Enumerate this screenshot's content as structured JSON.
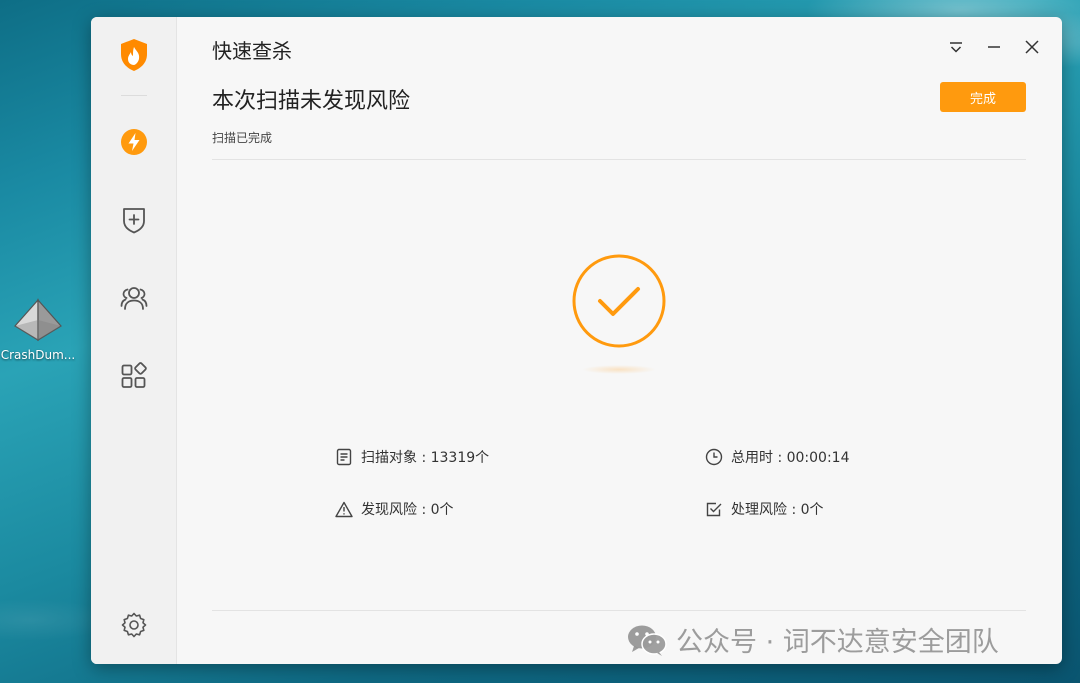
{
  "desktop": {
    "icon_label": "CrashDum...",
    "icon_name": "crashdump-pyramid-icon"
  },
  "window": {
    "title": "快速查杀",
    "headline": "本次扫描未发现风险",
    "status": "扫描已完成",
    "done_label": "完成",
    "controls": [
      "menu-icon",
      "minimize-icon",
      "close-icon"
    ]
  },
  "sidebar": {
    "items": [
      {
        "icon": "shield-flame-logo-icon"
      },
      {
        "icon": "lightning-scan-icon"
      },
      {
        "icon": "shield-plus-icon"
      },
      {
        "icon": "users-icon"
      },
      {
        "icon": "apps-grid-icon"
      },
      {
        "icon": "settings-gear-icon"
      }
    ]
  },
  "result": {
    "icon": "check-circle-icon",
    "stats": {
      "scanned": "扫描对象 : 13319个",
      "duration": "总用时 : 00:00:14",
      "found": "发现风险 : 0个",
      "handled": "处理风险 : 0个"
    }
  },
  "watermark": {
    "text": "公众号 · 词不达意安全团队",
    "icon": "wechat-icon"
  },
  "colors": {
    "accent": "#ff9a0e",
    "window_bg": "#f7f7f7",
    "sidebar_bg": "#f1f1f1"
  }
}
